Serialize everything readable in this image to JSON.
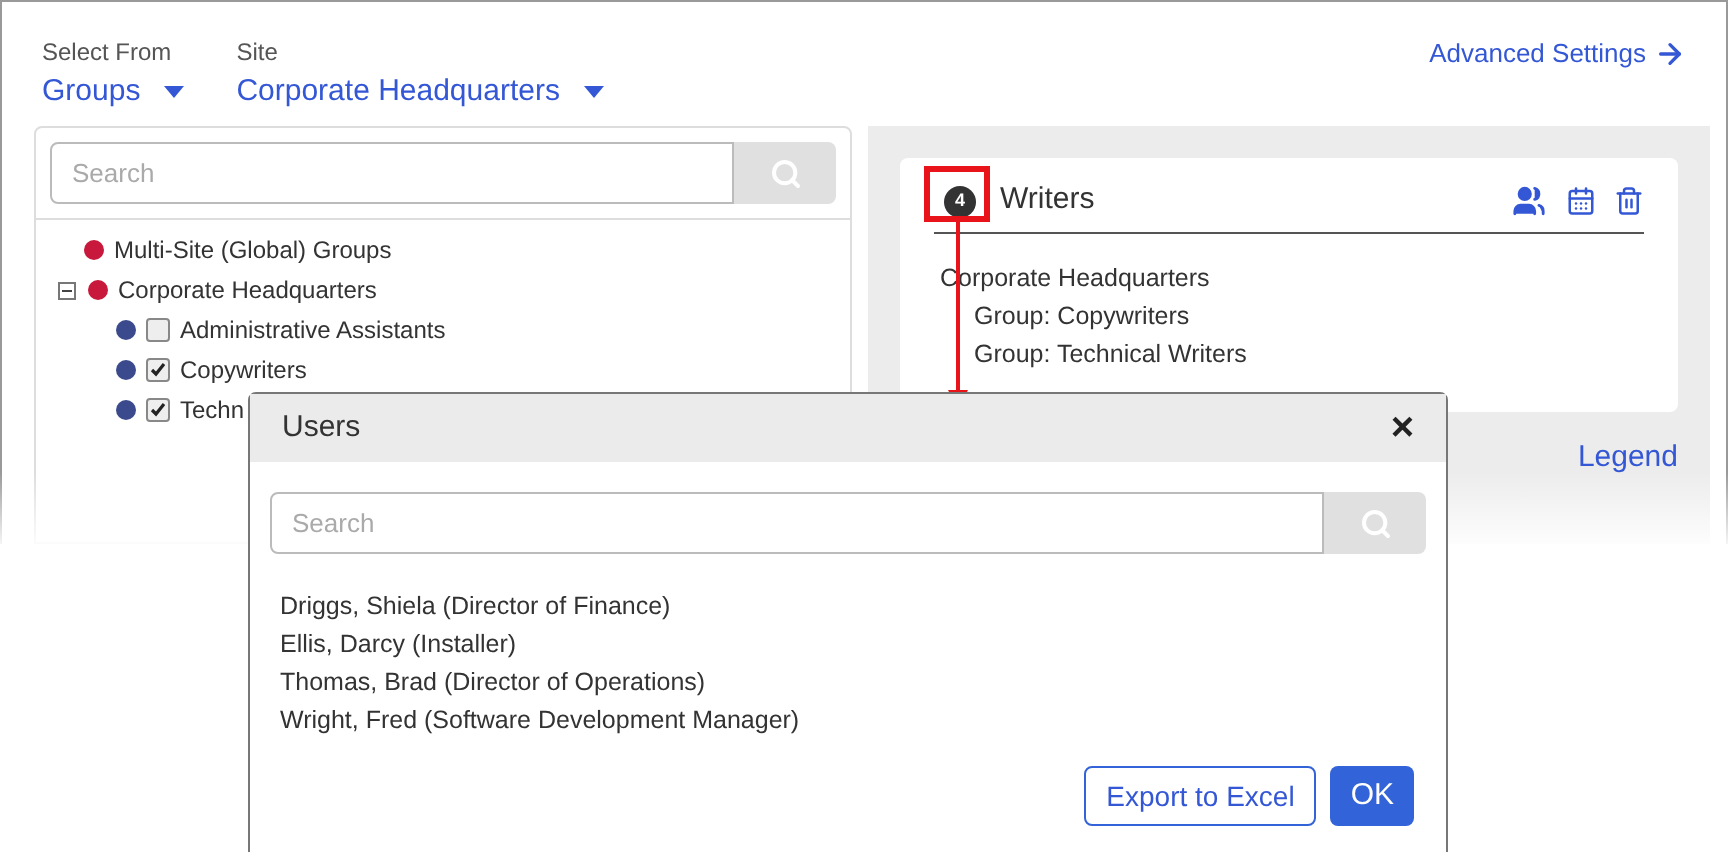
{
  "header": {
    "select_from": {
      "label": "Select From",
      "value": "Groups"
    },
    "site": {
      "label": "Site",
      "value": "Corporate Headquarters"
    },
    "advanced_link": "Advanced Settings"
  },
  "tree_panel": {
    "search": {
      "placeholder": "Search"
    },
    "items": [
      {
        "label": "Multi-Site (Global) Groups",
        "color": "#c8193c"
      },
      {
        "label": "Corporate Headquarters",
        "color": "#c8193c",
        "expanded": true,
        "children": [
          {
            "label": "Administrative Assistants",
            "color": "#3b4a8c",
            "checked": false
          },
          {
            "label": "Copywriters",
            "color": "#3b4a8c",
            "checked": true
          },
          {
            "label": "Techn",
            "color": "#3b4a8c",
            "checked": true
          }
        ]
      }
    ]
  },
  "group_card": {
    "count": "4",
    "title": "Writers",
    "site": "Corporate Headquarters",
    "groups": [
      "Group: Copywriters",
      "Group: Technical Writers"
    ]
  },
  "legend_link": "Legend",
  "dialog": {
    "title": "Users",
    "close": "×",
    "search": {
      "placeholder": "Search"
    },
    "users": [
      "Driggs, Shiela (Director of Finance)",
      "Ellis, Darcy (Installer)",
      "Thomas, Brad (Director of Operations)",
      "Wright, Fred (Software Development Manager)"
    ],
    "buttons": [
      {
        "label": "Export to Excel",
        "kind": "secondary"
      },
      {
        "label": "OK",
        "kind": "primary"
      }
    ]
  }
}
